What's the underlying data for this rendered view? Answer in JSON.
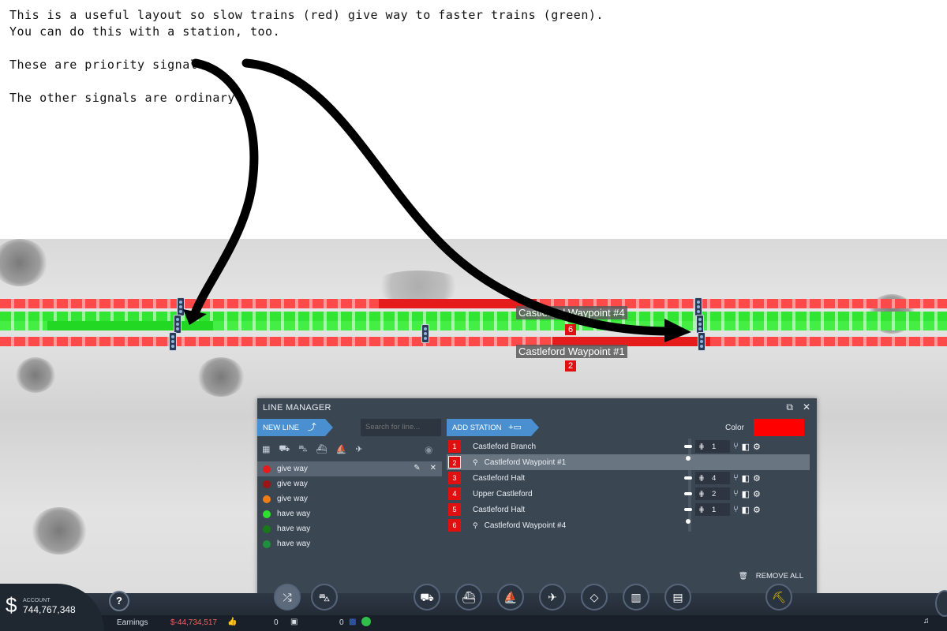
{
  "notes": {
    "line1": "This is a useful layout so slow trains (red) give way to faster trains (green).",
    "line2": "You can do this with a station, too.",
    "line3": "These are priority signals:",
    "line4": "The other signals are ordinary."
  },
  "map": {
    "waypoint_labels": [
      "Castleford Waypoint #4",
      "Castleford Waypoint #1"
    ],
    "waypoint_numbers": [
      "6",
      "2"
    ]
  },
  "line_manager": {
    "title": "LINE MANAGER",
    "new_line_label": "NEW LINE",
    "search_placeholder": "Search for line...",
    "add_station_label": "ADD STATION",
    "color_label": "Color",
    "color_value": "#ff0000",
    "remove_all_label": "REMOVE ALL",
    "lines": [
      {
        "name": "give way",
        "color": "#e51c1c",
        "selected": true
      },
      {
        "name": "give way",
        "color": "#9c1414"
      },
      {
        "name": "give way",
        "color": "#f07d14"
      },
      {
        "name": "have way",
        "color": "#2fe12f"
      },
      {
        "name": "have way",
        "color": "#177a17"
      },
      {
        "name": "have way",
        "color": "#1e8f3c"
      }
    ],
    "stops": [
      {
        "num": "1",
        "name": "Castleford Branch",
        "waypoint": false,
        "platform": "1"
      },
      {
        "num": "2",
        "name": "Castleford Waypoint #1",
        "waypoint": true,
        "selected": true
      },
      {
        "num": "3",
        "name": "Castleford Halt",
        "waypoint": false,
        "platform": "4"
      },
      {
        "num": "4",
        "name": "Upper Castleford",
        "waypoint": false,
        "platform": "2"
      },
      {
        "num": "5",
        "name": "Castleford Halt",
        "waypoint": false,
        "platform": "1"
      },
      {
        "num": "6",
        "name": "Castleford Waypoint #4",
        "waypoint": true
      }
    ]
  },
  "hud": {
    "account_label": "ACCOUNT",
    "account_value": "744,767,348",
    "earnings_label": "Earnings",
    "earnings_value": "$-44,734,517",
    "count_a": "0",
    "count_b": "0",
    "help": "?"
  }
}
